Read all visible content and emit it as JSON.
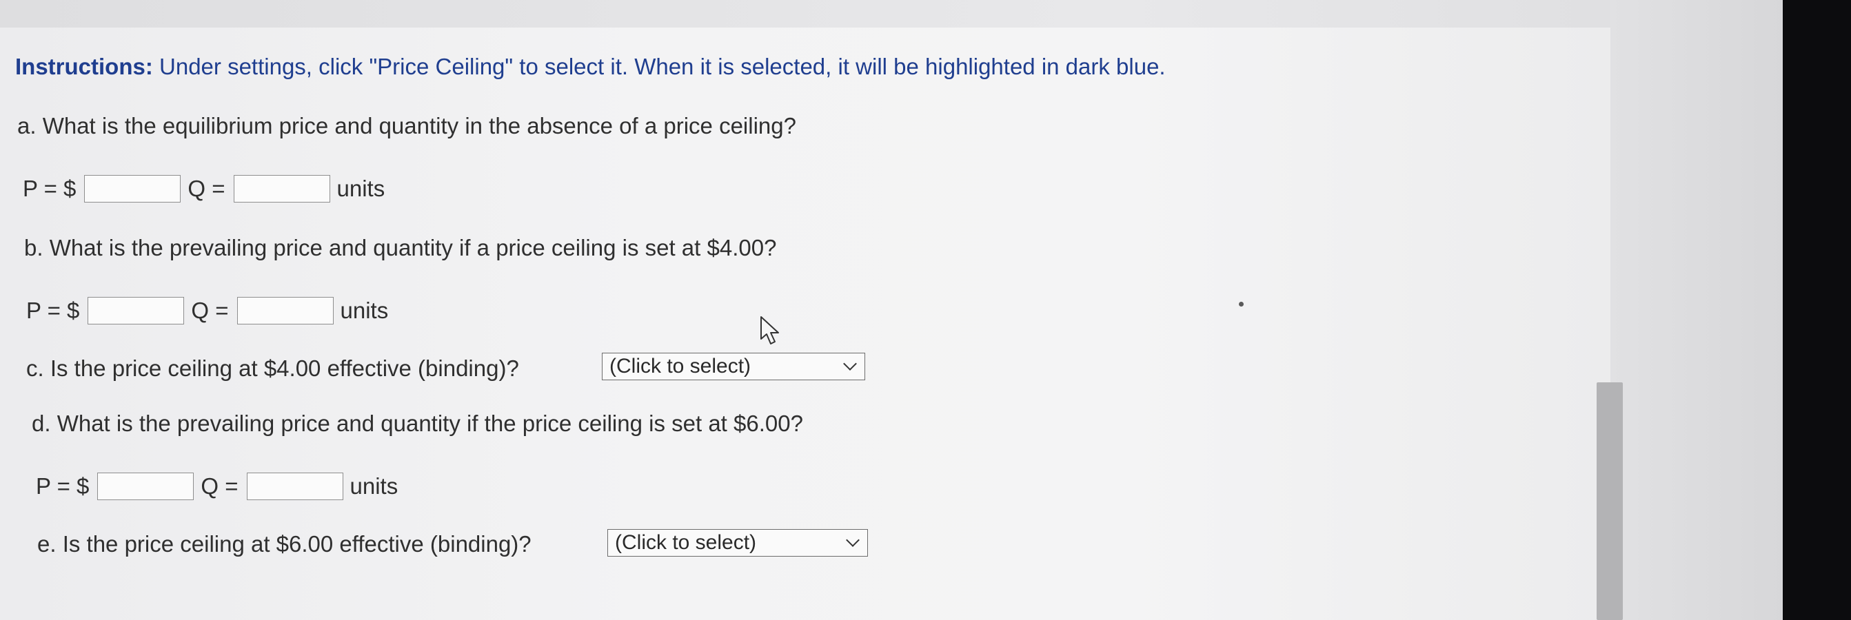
{
  "instructions": {
    "label": "Instructions:",
    "text": "Under settings, click \"Price Ceiling\" to select it. When it is selected, it will be highlighted in dark blue."
  },
  "questions": {
    "a": {
      "text": "a. What is the equilibrium price and quantity in the absence of a price ceiling?",
      "p_label": "P = $",
      "q_label": "Q =",
      "units": "units",
      "p_value": "",
      "q_value": ""
    },
    "b": {
      "text": "b. What is the prevailing price and quantity if a price ceiling is set at $4.00?",
      "p_label": "P = $",
      "q_label": "Q =",
      "units": "units",
      "p_value": "",
      "q_value": ""
    },
    "c": {
      "text": "c. Is the price ceiling at $4.00 effective (binding)?",
      "select_value": "(Click to select)"
    },
    "d": {
      "text": "d. What is the prevailing price and quantity if the price ceiling is set at $6.00?",
      "p_label": "P = $",
      "q_label": "Q =",
      "units": "units",
      "p_value": "",
      "q_value": ""
    },
    "e": {
      "text": "e. Is the price ceiling at $6.00 effective (binding)?",
      "select_value": "(Click to select)"
    }
  },
  "icons": {
    "cursor": "mouse-pointer-icon",
    "dropdown": "chevron-down-icon"
  },
  "colors": {
    "instructions": "#1f3e8f",
    "text": "#2f2f2f",
    "scrollbar": "#b3b3b5"
  }
}
